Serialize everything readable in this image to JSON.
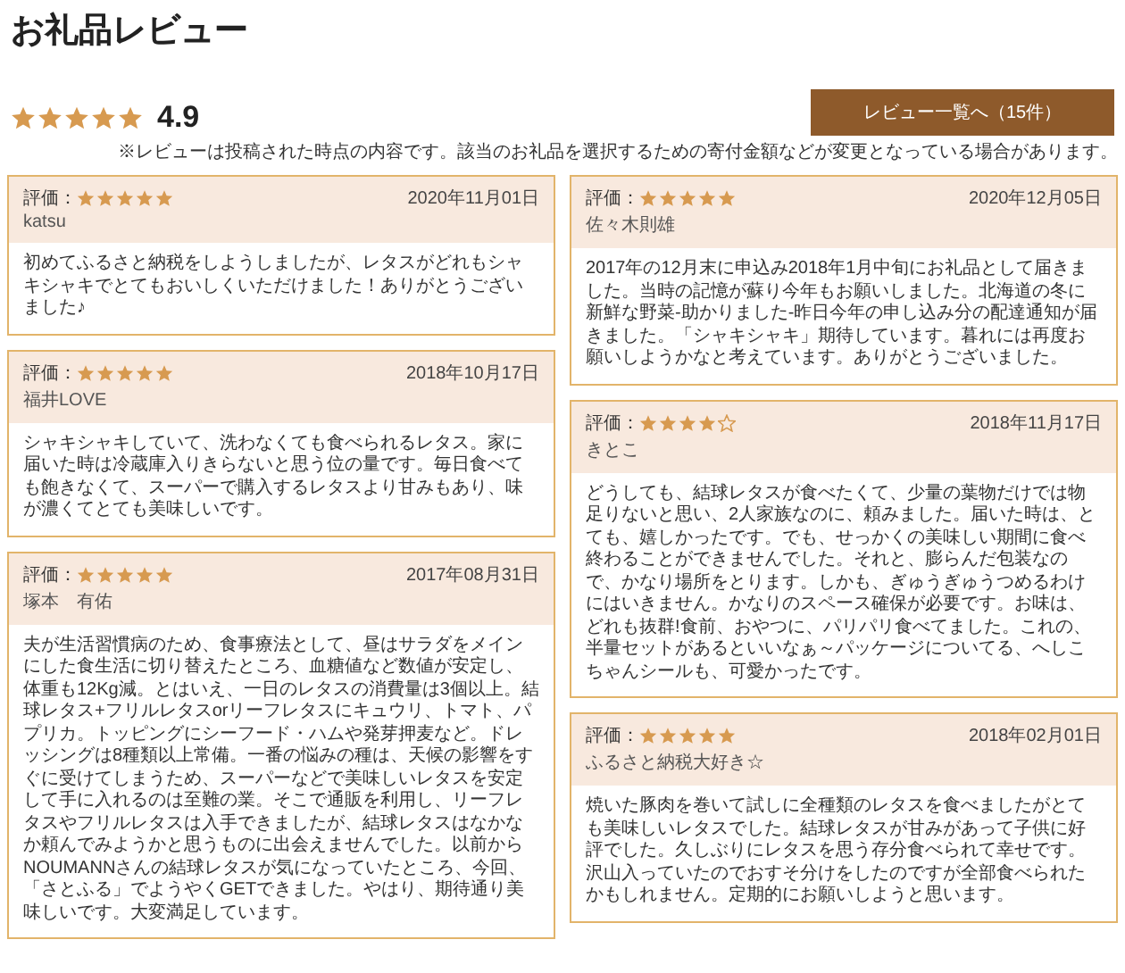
{
  "title": "お礼品レビュー",
  "summary": {
    "stars": 5,
    "score": "4.9"
  },
  "list_button": "レビュー一覧へ（15件）",
  "note": "※レビューは投稿された時点の内容です。該当のお礼品を選択するための寄付金額などが変更となっている場合があります。",
  "reviews": [
    {
      "rating_label": "評価：",
      "stars": 5,
      "date": "2020年11月01日",
      "author": "katsu",
      "text": "初めてふるさと納税をしようしましたが、レタスがどれもシャキシャキでとてもおいしくいただけました！ありがとうございました♪"
    },
    {
      "rating_label": "評価：",
      "stars": 5,
      "date": "2020年12月05日",
      "author": "佐々木則雄",
      "text": "2017年の12月末に申込み2018年1月中旬にお礼品として届きました。当時の記憶が蘇り今年もお願いしました。北海道の冬に新鮮な野菜-助かりました-昨日今年の申し込み分の配達通知が届きました。「シャキシャキ」期待しています。暮れには再度お願いしようかなと考えています。ありがとうございました。"
    },
    {
      "rating_label": "評価：",
      "stars": 5,
      "date": "2018年10月17日",
      "author": "福井LOVE",
      "text": "シャキシャキしていて、洗わなくても食べられるレタス。家に届いた時は冷蔵庫入りきらないと思う位の量です。毎日食べても飽きなくて、スーパーで購入するレタスより甘みもあり、味が濃くてとても美味しいです。"
    },
    {
      "rating_label": "評価：",
      "stars": 4,
      "date": "2018年11月17日",
      "author": "きとこ",
      "text": "どうしても、結球レタスが食べたくて、少量の葉物だけでは物足りないと思い、2人家族なのに、頼みました。届いた時は、とても、嬉しかったです。でも、せっかくの美味しい期間に食べ終わることができませんでした。それと、膨らんだ包装なので、かなり場所をとります。しかも、ぎゅうぎゅうつめるわけにはいきません。かなりのスペース確保が必要です。お味は、どれも抜群!食前、おやつに、パリパリ食べてました。これの、半量セットがあるといいなぁ～パッケージについてる、へしこちゃんシールも、可愛かったです。"
    },
    {
      "rating_label": "評価：",
      "stars": 5,
      "date": "2017年08月31日",
      "author": "塚本　有佑",
      "text": "夫が生活習慣病のため、食事療法として、昼はサラダをメインにした食生活に切り替えたところ、血糖値など数値が安定し、体重も12Kg減。とはいえ、一日のレタスの消費量は3個以上。結球レタス+フリルレタスorリーフレタスにキュウリ、トマト、パプリカ。トッピングにシーフード・ハムや発芽押麦など。ドレッシングは8種類以上常備。一番の悩みの種は、天候の影響をすぐに受けてしまうため、スーパーなどで美味しいレタスを安定して手に入れるのは至難の業。そこで通販を利用し、リーフレタスやフリルレタスは入手できましたが、結球レタスはなかなか頼んでみようかと思うものに出会えませんでした。以前からNOUMANNさんの結球レタスが気になっていたところ、今回、「さとふる」でようやくGETできました。やはり、期待通り美味しいです。大変満足しています。"
    },
    {
      "rating_label": "評価：",
      "stars": 5,
      "date": "2018年02月01日",
      "author": "ふるさと納税大好き☆",
      "text": "焼いた豚肉を巻いて試しに全種類のレタスを食べましたがとても美味しいレタスでした。結球レタスが甘みがあって子供に好評でした。久しぶりにレタスを思う存分食べられて幸せです。沢山入っていたのでおすそ分けをしたのですが全部食べられたかもしれません。定期的にお願いしようと思います。"
    }
  ]
}
